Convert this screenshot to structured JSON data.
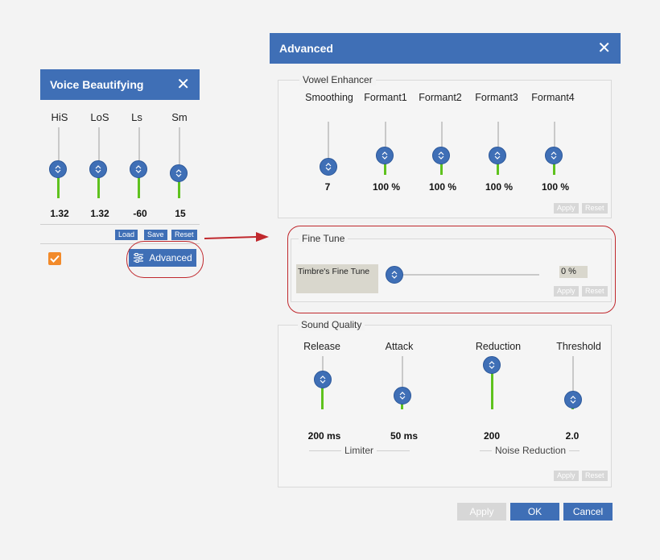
{
  "voice_panel": {
    "title": "Voice Beautifying",
    "sliders": [
      {
        "label": "HiS",
        "value": "1.32",
        "level": 0.45
      },
      {
        "label": "LoS",
        "value": "1.32",
        "level": 0.45
      },
      {
        "label": "Ls",
        "value": "-60",
        "level": 0.45
      },
      {
        "label": "Sm",
        "value": "15",
        "level": 0.39
      }
    ],
    "buttons": {
      "load": "Load",
      "save": "Save",
      "reset": "Reset"
    },
    "checkbox_checked": true,
    "advanced_label": "Advanced"
  },
  "advanced_dialog": {
    "title": "Advanced",
    "vowel_enhancer": {
      "legend": "Vowel Enhancer",
      "sliders": [
        {
          "label": "Smoothing",
          "value": "7",
          "level": 0.0
        },
        {
          "label": "Formant1",
          "value": "100 %",
          "level": 0.35
        },
        {
          "label": "Formant2",
          "value": "100 %",
          "level": 0.35
        },
        {
          "label": "Formant3",
          "value": "100 %",
          "level": 0.35
        },
        {
          "label": "Formant4",
          "value": "100 %",
          "level": 0.35
        }
      ],
      "apply": "Apply",
      "reset": "Reset"
    },
    "fine_tune": {
      "legend": "Fine Tune",
      "label": "Timbre's Fine Tune",
      "value": "0 %",
      "level": 0.0,
      "apply": "Apply",
      "reset": "Reset"
    },
    "sound_quality": {
      "legend": "Sound Quality",
      "sliders": [
        {
          "label": "Release",
          "value": "200 ms",
          "level": 0.6
        },
        {
          "label": "Attack",
          "value": "50 ms",
          "level": 0.25
        },
        {
          "label": "Reduction",
          "value": "200",
          "level": 0.85
        },
        {
          "label": "Threshold",
          "value": "2.0",
          "level": 0.1
        }
      ],
      "group_labels": {
        "limiter": "Limiter",
        "noise_reduction": "Noise Reduction"
      },
      "apply": "Apply",
      "reset": "Reset"
    },
    "footer": {
      "apply": "Apply",
      "ok": "OK",
      "cancel": "Cancel"
    }
  },
  "colors": {
    "accent": "#3f6fb6",
    "fill": "#5fc21e",
    "highlight": "#c0282d",
    "checkbox": "#f28a2a"
  }
}
